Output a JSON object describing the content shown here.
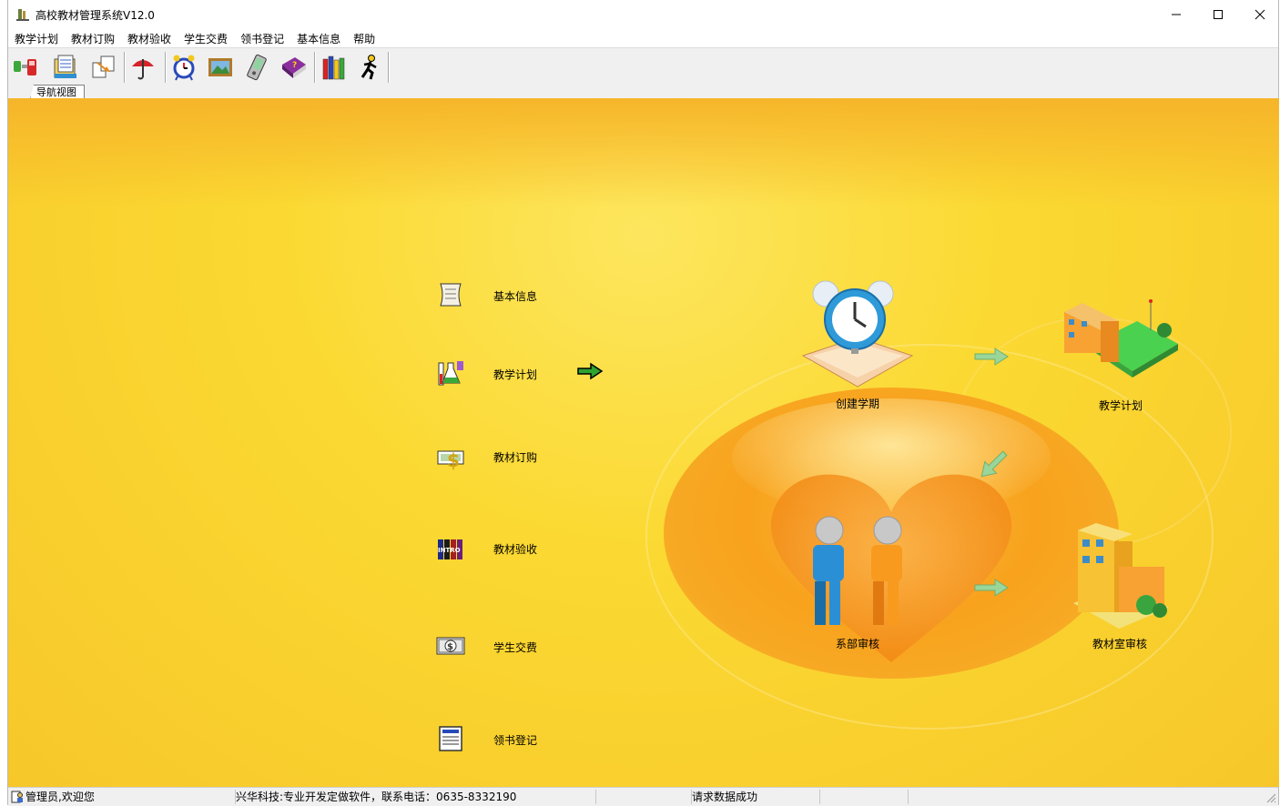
{
  "window": {
    "title": "高校教材管理系统V12.0",
    "controls": {
      "minimize": "—",
      "maximize": "☐",
      "close": "✕"
    }
  },
  "menubar": {
    "items": [
      "教学计划",
      "教材订购",
      "教材验收",
      "学生交费",
      "领书登记",
      "基本信息",
      "帮助"
    ]
  },
  "toolbar": {
    "buttons": [
      "connect-icon",
      "document-folder-icon",
      "copy-docs-icon",
      "umbrella-icon",
      "alarm-clock-icon",
      "picture-frame-icon",
      "pda-icon",
      "help-book-icon",
      "books-icon",
      "exit-runner-icon"
    ]
  },
  "tabs": {
    "nav_tab": "导航视图"
  },
  "nav": {
    "items": [
      {
        "label": "基本信息",
        "icon": "scroll-icon"
      },
      {
        "label": "教学计划",
        "icon": "lab-icon"
      },
      {
        "label": "教材订购",
        "icon": "money-book-icon"
      },
      {
        "label": "教材验收",
        "icon": "intro-books-icon"
      },
      {
        "label": "学生交费",
        "icon": "dollar-note-icon"
      },
      {
        "label": "领书登记",
        "icon": "register-icon"
      }
    ],
    "active_arrow": "go-arrow-icon"
  },
  "flow": {
    "create_term": "创建学期",
    "teaching_plan": "教学计划",
    "dept_review": "系部审核",
    "material_review": "教材室审核"
  },
  "statusbar": {
    "user": "管理员,欢迎您",
    "company": "兴华科技:专业开发定做软件，联系电话：0635-8332190",
    "message": "请求数据成功"
  },
  "colors": {
    "background_yellow": "#fbd932",
    "glow_orange": "#f8a21d",
    "arrow_green": "#8fd694"
  }
}
